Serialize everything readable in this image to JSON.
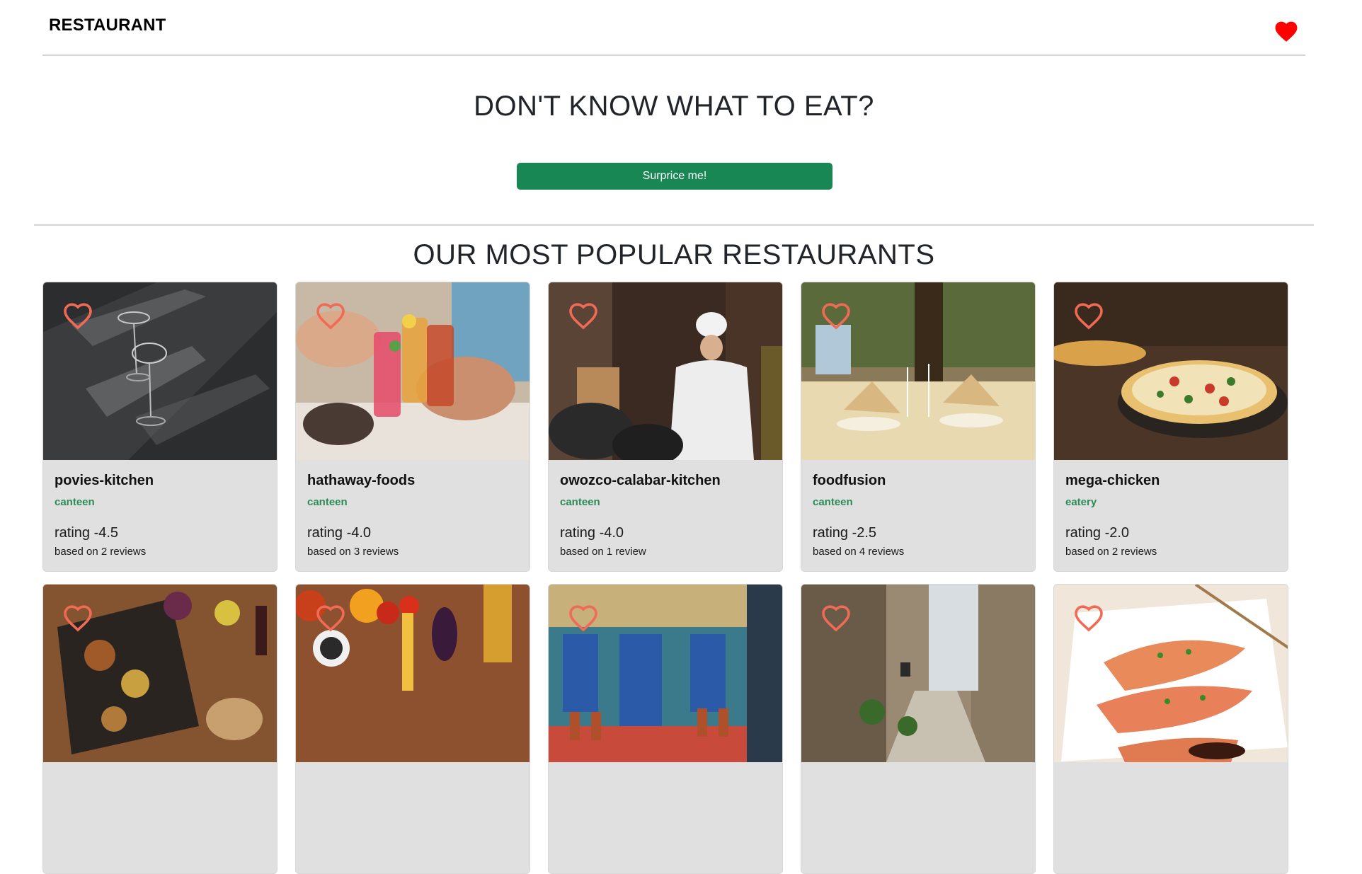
{
  "navbar": {
    "brand": "RESTAURANT",
    "favorites_icon": "heart-filled-icon",
    "favorites_color": "#ff0000"
  },
  "hero": {
    "title": "DON'T KNOW WHAT TO EAT?",
    "button_label": "Surprice me!",
    "button_color": "#198754"
  },
  "popular": {
    "title": "OUR MOST POPULAR RESTAURANTS",
    "accent_color": "#2e8b57",
    "card_heart_icon": "heart-outline-icon",
    "card_heart_color": "#f06a55",
    "cards": [
      {
        "name": "povies-kitchen",
        "type": "canteen",
        "rating": "rating -4.5",
        "reviews": "based on 2 reviews"
      },
      {
        "name": "hathaway-foods",
        "type": "canteen",
        "rating": "rating -4.0",
        "reviews": "based on 3 reviews"
      },
      {
        "name": "owozco-calabar-kitchen",
        "type": "canteen",
        "rating": "rating -4.0",
        "reviews": "based on 1 review"
      },
      {
        "name": "foodfusion",
        "type": "canteen",
        "rating": "rating -2.5",
        "reviews": "based on 4 reviews"
      },
      {
        "name": "mega-chicken",
        "type": "eatery",
        "rating": "rating -2.0",
        "reviews": "based on 2 reviews"
      }
    ],
    "second_row_images": [
      "food-platter-photo",
      "vegetables-pasta-photo",
      "street-cafe-photo",
      "stone-alley-photo",
      "salmon-dish-photo"
    ]
  }
}
